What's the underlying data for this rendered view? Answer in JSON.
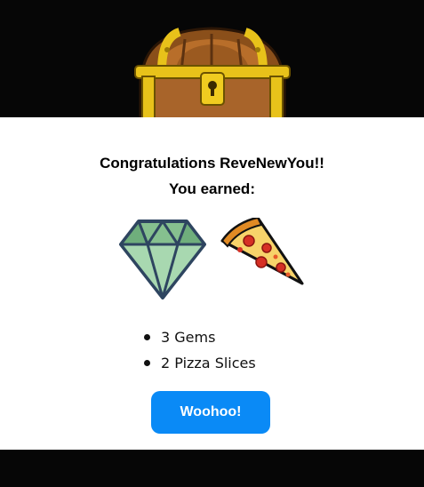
{
  "modal": {
    "heading_line1": "Congratulations ReveNewYou!!",
    "heading_line2": "You earned:",
    "reward_items": [
      {
        "label": "3 Gems",
        "icon": "gem-icon"
      },
      {
        "label": "2 Pizza Slices",
        "icon": "pizza-slice-icon"
      }
    ],
    "confirm_label": "Woohoo!"
  },
  "theme": {
    "backdrop": "#060606",
    "panel": "#ffffff",
    "button": "#0a8af6",
    "gem": "#7fbf8a",
    "pizza_crust": "#f2a33a",
    "pizza_topping": "#d62f24"
  }
}
